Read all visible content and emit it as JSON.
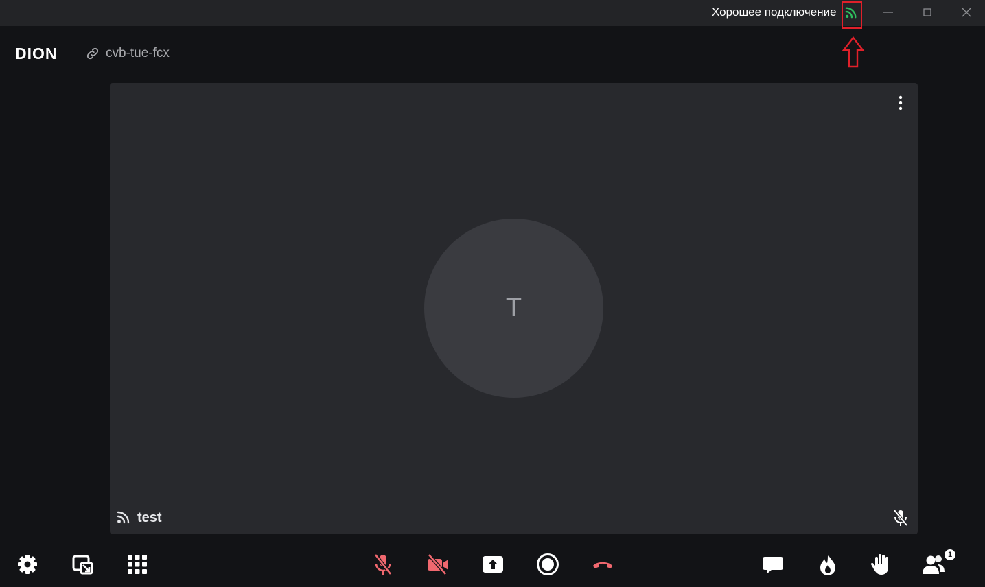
{
  "titlebar": {
    "connection_status": "Хорошее подключение",
    "connection_icon": "signal-icon",
    "connection_color": "#2fbf5e",
    "highlight_color": "#e0202a"
  },
  "header": {
    "logo_text": "DION",
    "room_icon": "link-icon",
    "room_id": "cvb-tue-fcx"
  },
  "tile": {
    "avatar_letter": "T",
    "participant_name": "test",
    "mic_state_icon": "mic-off-icon",
    "menu_icon": "more-vertical-icon"
  },
  "toolbar": {
    "left": [
      "settings-icon",
      "picture-in-picture-icon",
      "grid-icon"
    ],
    "center": [
      "mic-off-icon",
      "camera-off-icon",
      "share-screen-icon",
      "record-icon",
      "hang-up-icon"
    ],
    "right": [
      "chat-icon",
      "reaction-icon",
      "raise-hand-icon",
      "participants-icon"
    ],
    "participants_count": "1",
    "danger_color": "#f0686f"
  }
}
